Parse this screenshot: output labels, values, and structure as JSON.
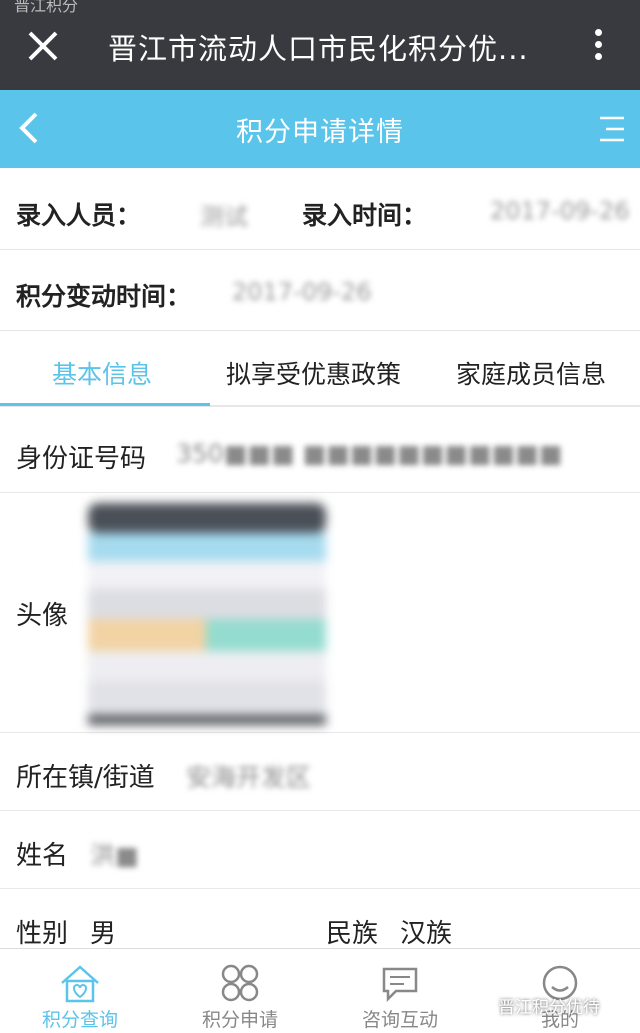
{
  "wechat_bar": {
    "title": "晋江市流动人口市民化积分优...",
    "status_text": "晋江积分"
  },
  "header": {
    "title": "积分申请详情"
  },
  "entry": {
    "recorder_label": "录入人员：",
    "recorder_value": "测试",
    "time_label": "录入时间：",
    "time_value": "2017-09-26",
    "change_time_label": "积分变动时间：",
    "change_time_value": "2017-09-26"
  },
  "tabs": [
    {
      "label": "基本信息",
      "active": true
    },
    {
      "label": "拟享受优惠政策",
      "active": false
    },
    {
      "label": "家庭成员信息",
      "active": false
    }
  ],
  "details": {
    "id_label": "身份证号码",
    "id_value": "350■■■ ■■■■■■■■■■■",
    "avatar_label": "头像",
    "town_label": "所在镇/街道",
    "town_value": "安海开发区",
    "name_label": "姓名",
    "name_value": "洪■",
    "gender_label": "性别",
    "gender_value": "男",
    "ethnicity_label": "民族",
    "ethnicity_value": "汉族"
  },
  "bottom_nav": [
    {
      "label": "积分查询",
      "icon": "house-icon",
      "active": true
    },
    {
      "label": "积分申请",
      "icon": "grid-icon",
      "active": false
    },
    {
      "label": "咨询互动",
      "icon": "chat-icon",
      "active": false
    },
    {
      "label": "我的",
      "icon": "profile-icon",
      "active": false
    }
  ],
  "watermark": "晋江积分优待",
  "colors": {
    "accent": "#5bc4ea",
    "wechat_bar": "#393a3f"
  }
}
